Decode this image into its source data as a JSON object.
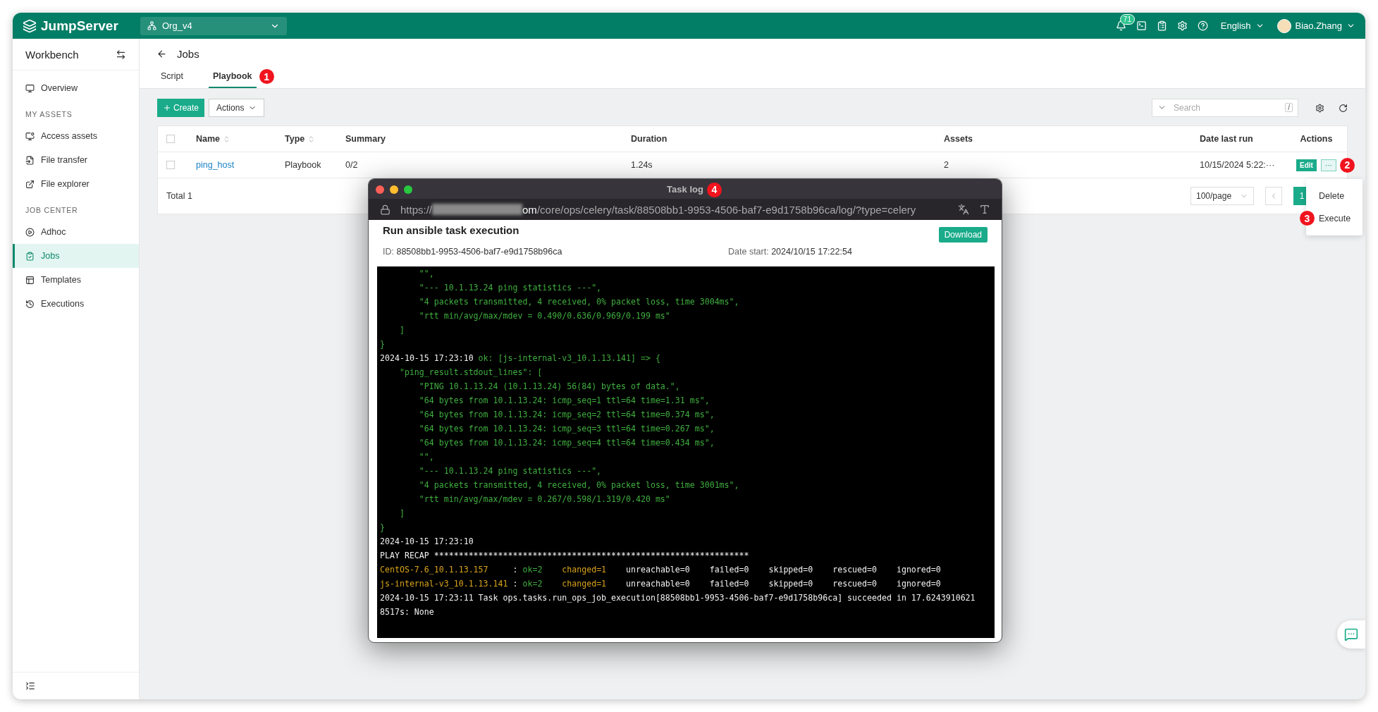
{
  "topbar": {
    "logo": "JumpServer",
    "org": "Org_v4",
    "notification_count": "71",
    "language": "English",
    "user": "Biao.Zhang"
  },
  "sidebar": {
    "title": "Workbench",
    "sections": [
      {
        "items": [
          {
            "label": "Overview",
            "selected": false
          }
        ]
      },
      {
        "heading": "MY ASSETS",
        "items": [
          {
            "label": "Access assets",
            "selected": false
          },
          {
            "label": "File transfer",
            "selected": false
          },
          {
            "label": "File explorer",
            "selected": false
          }
        ]
      },
      {
        "heading": "JOB CENTER",
        "items": [
          {
            "label": "Adhoc",
            "selected": false
          },
          {
            "label": "Jobs",
            "selected": true
          },
          {
            "label": "Templates",
            "selected": false
          },
          {
            "label": "Executions",
            "selected": false
          }
        ]
      }
    ]
  },
  "page": {
    "title": "Jobs",
    "tabs": [
      {
        "label": "Script",
        "selected": false
      },
      {
        "label": "Playbook",
        "selected": true,
        "marker": "1"
      }
    ]
  },
  "toolbar": {
    "create": "Create",
    "actions": "Actions",
    "search_placeholder": "Search",
    "search_key": "/"
  },
  "table": {
    "all_checked": false,
    "columns": [
      {
        "label": "Name",
        "sortable": true
      },
      {
        "label": "Type",
        "sortable": true
      },
      {
        "label": "Summary",
        "sortable": false
      },
      {
        "label": "Duration",
        "sortable": false
      },
      {
        "label": "Assets",
        "sortable": false
      },
      {
        "label": "Date last run",
        "sortable": false
      },
      {
        "label": "Actions",
        "sortable": false
      }
    ],
    "rows": [
      {
        "checked": false,
        "name": "ping_host",
        "type": "Playbook",
        "summary": "0/2",
        "duration": "1.24s",
        "assets": "2",
        "date_last_run": "10/15/2024 5:22:···",
        "edit": "Edit",
        "more": "···",
        "marker": "2"
      }
    ],
    "total": "Total 1",
    "page_size": "100/page",
    "pages": [
      {
        "label": "1",
        "selected": true
      }
    ]
  },
  "menu": [
    {
      "label": "Delete"
    },
    {
      "label": "Execute",
      "marker": "3"
    }
  ],
  "task_log": {
    "title": "Task log",
    "marker": "4",
    "url": {
      "scheme": "https://",
      "host_tail": "om",
      "path": "/core/ops/celery/task/88508bb1-9953-4506-baf7-e9d1758b96ca/log/?type=celery"
    },
    "heading": "Run ansible task execution",
    "download": "Download",
    "id_label": "ID:",
    "id": "88508bb1-9953-4506-baf7-e9d1758b96ca",
    "date_label": "Date start:",
    "date": "2024/10/15 17:22:54",
    "lines": [
      [
        {
          "kind": "ok",
          "text": "        \"\","
        }
      ],
      [
        {
          "kind": "ok",
          "text": "        \"--- 10.1.13.24 ping statistics ---\","
        }
      ],
      [
        {
          "kind": "ok",
          "text": "        \"4 packets transmitted, 4 received, 0% packet loss, time 3004ms\","
        }
      ],
      [
        {
          "kind": "ok",
          "text": "        \"rtt min/avg/max/mdev = 0.490/0.636/0.969/0.199 ms\""
        }
      ],
      [
        {
          "kind": "ok",
          "text": "    ]"
        }
      ],
      [
        {
          "kind": "ok",
          "text": "}"
        }
      ],
      [
        {
          "kind": "plain",
          "text": "2024-10-15 17:23:10 "
        },
        {
          "kind": "ok",
          "text": "ok: [js-internal-v3_10.1.13.141] => {"
        }
      ],
      [
        {
          "kind": "ok",
          "text": "    \"ping_result.stdout_lines\": ["
        }
      ],
      [
        {
          "kind": "ok",
          "text": "        \"PING 10.1.13.24 (10.1.13.24) 56(84) bytes of data.\","
        }
      ],
      [
        {
          "kind": "ok",
          "text": "        \"64 bytes from 10.1.13.24: icmp_seq=1 ttl=64 time=1.31 ms\","
        }
      ],
      [
        {
          "kind": "ok",
          "text": "        \"64 bytes from 10.1.13.24: icmp_seq=2 ttl=64 time=0.374 ms\","
        }
      ],
      [
        {
          "kind": "ok",
          "text": "        \"64 bytes from 10.1.13.24: icmp_seq=3 ttl=64 time=0.267 ms\","
        }
      ],
      [
        {
          "kind": "ok",
          "text": "        \"64 bytes from 10.1.13.24: icmp_seq=4 ttl=64 time=0.434 ms\","
        }
      ],
      [
        {
          "kind": "ok",
          "text": "        \"\","
        }
      ],
      [
        {
          "kind": "ok",
          "text": "        \"--- 10.1.13.24 ping statistics ---\","
        }
      ],
      [
        {
          "kind": "ok",
          "text": "        \"4 packets transmitted, 4 received, 0% packet loss, time 3001ms\","
        }
      ],
      [
        {
          "kind": "ok",
          "text": "        \"rtt min/avg/max/mdev = 0.267/0.598/1.319/0.420 ms\""
        }
      ],
      [
        {
          "kind": "ok",
          "text": "    ]"
        }
      ],
      [
        {
          "kind": "ok",
          "text": "}"
        }
      ],
      [
        {
          "kind": "plain",
          "text": "2024-10-15 17:23:10"
        }
      ],
      [
        {
          "kind": "plain",
          "text": "PLAY RECAP ****************************************************************"
        }
      ],
      [
        {
          "kind": "warn",
          "text": "CentOS-7.6_10.1.13.157"
        },
        {
          "kind": "plain",
          "text": "     : "
        },
        {
          "kind": "ok",
          "text": "ok=2"
        },
        {
          "kind": "warn",
          "text": "    changed=1"
        },
        {
          "kind": "plain",
          "text": "    unreachable=0    failed=0    skipped=0    rescued=0    ignored=0"
        }
      ],
      [
        {
          "kind": "warn",
          "text": "js-internal-v3_10.1.13.141"
        },
        {
          "kind": "plain",
          "text": " : "
        },
        {
          "kind": "ok",
          "text": "ok=2"
        },
        {
          "kind": "warn",
          "text": "    changed=1"
        },
        {
          "kind": "plain",
          "text": "    unreachable=0    failed=0    skipped=0    rescued=0    ignored=0"
        }
      ],
      [
        {
          "kind": "plain",
          "text": "2024-10-15 17:23:11 Task ops.tasks.run_ops_job_execution[88508bb1-9953-4506-baf7-e9d1758b96ca] succeeded in 17.6243910621"
        }
      ],
      [
        {
          "kind": "plain",
          "text": "8517s: None"
        }
      ]
    ]
  }
}
